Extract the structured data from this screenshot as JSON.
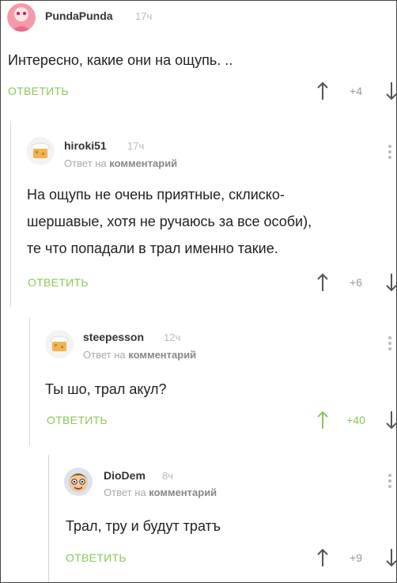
{
  "comments": [
    {
      "author": "PundaPunda",
      "time": "17ч",
      "reply_prefix": "",
      "reply_target": "",
      "text": "Интересно, какие они на ощупь. ..",
      "lines": [
        "Интересно, какие они на ощупь. .."
      ],
      "reply_label": "ОТВЕТИТЬ",
      "score": "+4",
      "upvoted": false,
      "avatar": "pink-face-avatar"
    },
    {
      "author": "hiroki51",
      "time": "17ч",
      "reply_prefix": "Ответ на",
      "reply_target": "комментарий",
      "lines": [
        "На ощупь не очень приятные, склиско-",
        "шершавые, хотя не ручаюсь за все особи),",
        "те что попадали в трал именно такие."
      ],
      "reply_label": "ОТВЕТИТЬ",
      "score": "+6",
      "upvoted": false,
      "avatar": "default-cookie-avatar"
    },
    {
      "author": "steepesson",
      "time": "12ч",
      "reply_prefix": "Ответ на",
      "reply_target": "комментарий",
      "lines": [
        "Ты шо, трал акул?"
      ],
      "reply_label": "ОТВЕТИТЬ",
      "score": "+40",
      "upvoted": true,
      "avatar": "default-cookie-avatar"
    },
    {
      "author": "DioDem",
      "time": "8ч",
      "reply_prefix": "Ответ на",
      "reply_target": "комментарий",
      "lines": [
        "Трал, тру и будут тратъ"
      ],
      "reply_label": "ОТВЕТИТЬ",
      "score": "+9",
      "upvoted": false,
      "avatar": "cartoon-face-avatar"
    }
  ],
  "colors": {
    "accent": "#8ac858",
    "muted": "#999999",
    "thread": "#d6d6d6"
  }
}
